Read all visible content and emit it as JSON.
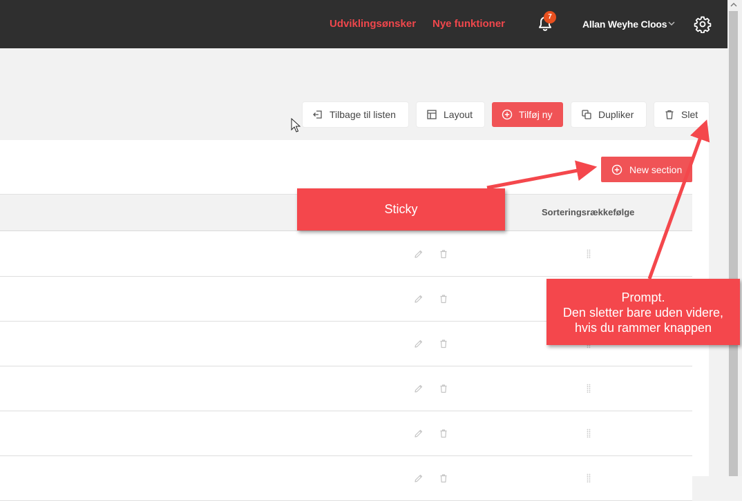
{
  "header": {
    "link_wishes": "Udviklingsønsker",
    "link_features": "Nye funktioner",
    "notification_count": "7",
    "user_name": "Allan Weyhe Cloos"
  },
  "toolbar": {
    "back_label": "Tilbage til listen",
    "layout_label": "Layout",
    "add_label": "Tilføj ny",
    "duplicate_label": "Dupliker",
    "delete_label": "Slet"
  },
  "section": {
    "new_section_label": "New section"
  },
  "table": {
    "sort_header": "Sorteringsrækkefølge",
    "rows": 6
  },
  "annotations": {
    "sticky": "Sticky",
    "prompt_line1": "Prompt.",
    "prompt_line2": "Den sletter bare uden videre,",
    "prompt_line3": "hvis du rammer knappen"
  },
  "colors": {
    "accent": "#f05356",
    "topbar": "#2f2f2f",
    "badge": "#e8501f",
    "callout": "#f4474c"
  },
  "icons": [
    "bell-icon",
    "chevron-down-icon",
    "gear-icon",
    "back-icon",
    "layout-icon",
    "plus-circle-icon",
    "duplicate-icon",
    "trash-icon",
    "pencil-icon",
    "drag-handle-icon"
  ]
}
